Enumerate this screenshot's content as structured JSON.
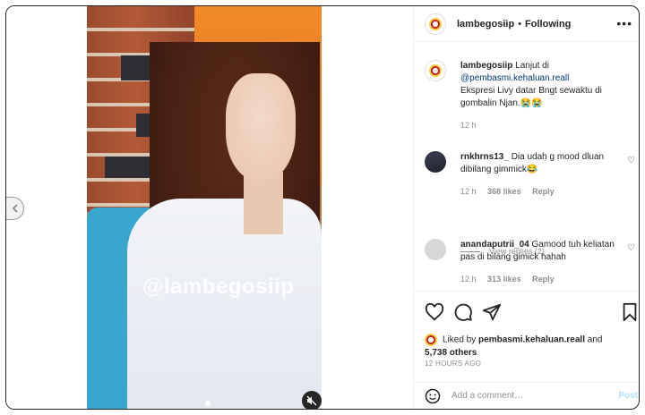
{
  "media": {
    "watermark": "@lambegosiip"
  },
  "header": {
    "username": "lambegosiip",
    "separator": "•",
    "follow_label": "Following",
    "more": "•••"
  },
  "caption": {
    "username": "lambegosiip",
    "text_1": "Lanjut di",
    "mention": "@pembasmi.kehaluan.reall",
    "text_2": "Ekspresi Livy datar Bngt sewaktu di gombalin Njan.😭😭",
    "time": "12 h"
  },
  "comments": [
    {
      "username": "rnkhrns13_",
      "text": "Dia udah g mood dluan dibilang gimmick😂",
      "time": "12 h",
      "likes": "368 likes",
      "reply": "Reply",
      "view_replies": "View replies (2)"
    },
    {
      "username": "anandaputrii_04",
      "text": "Gamood tuh keliatan pas di bilang gimick hahah",
      "time": "12 h",
      "likes": "313 likes",
      "reply": "Reply"
    }
  ],
  "likes": {
    "prefix": "Liked by",
    "user": "pembasmi.kehaluan.reall",
    "and": "and",
    "others": "5,738 others"
  },
  "timestamp": "12 HOURS AGO",
  "add_comment": {
    "placeholder": "Add a comment…",
    "post_label": "Post"
  },
  "icons": [
    "heart-icon",
    "comment-icon",
    "share-icon",
    "bookmark-icon",
    "emoji-icon",
    "mute-icon",
    "chevron-left-icon"
  ]
}
